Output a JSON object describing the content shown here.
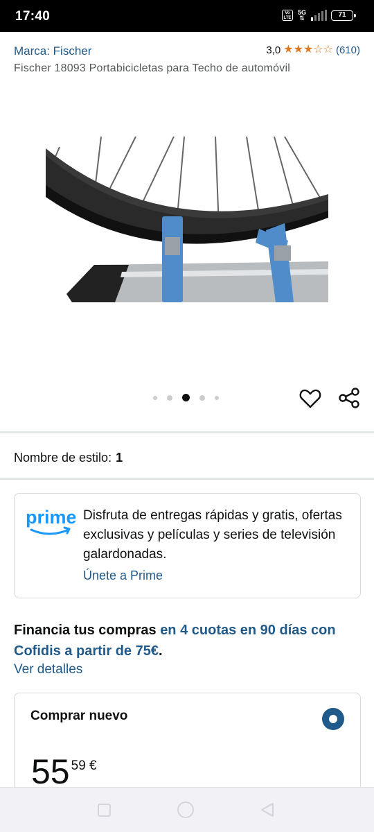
{
  "status_bar": {
    "time": "17:40",
    "volte": "Vo LTE",
    "network": "5G",
    "battery": "71"
  },
  "header": {
    "brand": "Marca: Fischer",
    "rating_value": "3,0",
    "rating_stars": 3,
    "rating_max": 5,
    "rating_count": "(610)",
    "title": "Fischer 18093 Portabicicletas para Techo de automóvil"
  },
  "gallery": {
    "image_subject": "bicycle-wheel-strapped-to-roof-rack",
    "image_count": 5,
    "active_index": 2
  },
  "style": {
    "label": "Nombre de estilo:",
    "value": "1"
  },
  "prime": {
    "logo_text": "prime",
    "description": "Disfruta de entregas rápidas y gratis, ofertas exclusivas y películas y series de televisión galardonadas.",
    "link": "Únete a Prime"
  },
  "financing": {
    "text_bold": "Financia tus compras",
    "text_highlight": "en 4 cuotas en 90 días con Cofidis a partir de 75€",
    "suffix": ".",
    "link": "Ver detalles"
  },
  "buy": {
    "label": "Comprar nuevo",
    "price_int": "55",
    "price_dec": "59 €"
  },
  "colors": {
    "link": "#1f5a8a",
    "star": "#de7921",
    "strap": "#4f8cc9"
  }
}
